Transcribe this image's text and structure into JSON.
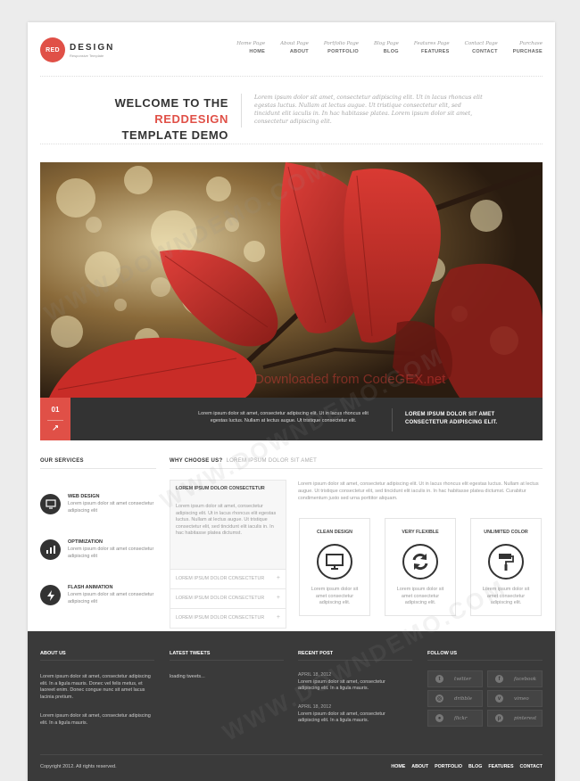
{
  "header": {
    "logo_badge": "RED",
    "logo_name": "DESIGN",
    "logo_tagline": "Responsive Template",
    "nav": [
      {
        "sub": "Home Page",
        "label": "HOME"
      },
      {
        "sub": "About Page",
        "label": "ABOUT"
      },
      {
        "sub": "Portfolio Page",
        "label": "PORTFOLIO"
      },
      {
        "sub": "Blog Page",
        "label": "BLOG"
      },
      {
        "sub": "Features Page",
        "label": "FEATURES"
      },
      {
        "sub": "Contact Page",
        "label": "CONTACT"
      },
      {
        "sub": "Purchase",
        "label": "PURCHASE"
      }
    ]
  },
  "welcome": {
    "line1_prefix": "WELCOME TO THE ",
    "line1_accent": "REDDESIGN",
    "line2": "TEMPLATE DEMO",
    "description": "Lorem ipsum dolor sit amet, consectetur adipiscing elit. Ut in lacus rhoncus elit egestas luctus. Nullam at lectus augue. Ut tristique consectetur elit, sed tincidunt elit iaculis in. In hac habitasse platea. Lorem ipsum dolor sit amet, consectetur adipiscing elit."
  },
  "slider": {
    "number": "01",
    "link_icon": "link-icon",
    "caption": "Lorem ipsum dolor sit amet, consectetur adipiscing elit. Ut in lacus rhoncus elit egestas luctus. Nullam at lectus augue. Ut tristique consectetur elit.",
    "heading": "LOREM IPSUM DOLOR SIT AMET CONSECTETUR ADIPISCING ELIT.",
    "overlay_text": "Downloaded from CodeGEX.net"
  },
  "services": {
    "title": "OUR SERVICES",
    "items": [
      {
        "icon": "monitor-icon",
        "title": "WEB DESIGN",
        "desc": "Lorem ipsum dolor sit amet consectetur adipiscing elit"
      },
      {
        "icon": "chart-icon",
        "title": "OPTIMIZATION",
        "desc": "Lorem ipsum dolor sit amet consectetur adipiscing elit"
      },
      {
        "icon": "flash-icon",
        "title": "FLASH ANIMATION",
        "desc": "Lorem ipsum dolor sit amet consectetur adipiscing elit"
      }
    ]
  },
  "why": {
    "title": "WHY CHOOSE US?",
    "subtitle": "LOREM IPSUM DOLOR SIT AMET",
    "accordion_open": {
      "title": "LOREM IPSUM DOLOR CONSECTETUR",
      "body": "Lorem ipsum dolor sit amet, consectetur adipiscing elit. Ut in lacus rhoncus elit egestas luctus. Nullam at lectus augue. Ut tristique consectetur elit, sed tincidunt elit iaculis in. In hac habitasse platea dictumst."
    },
    "accordion_closed": [
      "LOREM IPSUM DOLOR CONSECTETUR",
      "LOREM IPSUM DOLOR CONSECTETUR",
      "LOREM IPSUM DOLOR CONSECTETUR"
    ],
    "text": "Lorem ipsum dolor sit amet, consectetur adipiscing elit. Ut in lacus rhoncus elit egestas luctus. Nullam at lectus augue. Ut tristique consectetur elit, sed tincidunt elit iaculis in. In hac habitasse platea dictumst. Curabitur condimentum justo sed urna porttitor aliquam.",
    "features": [
      {
        "title": "CLEAN DESIGN",
        "icon": "monitor-icon",
        "desc": "Lorem ipsum dolor sit amet consectetur adipiscing elit."
      },
      {
        "title": "VERY FLEXIBLE",
        "icon": "refresh-icon",
        "desc": "Lorem ipsum dolor sit amet consectetur adipiscing elit."
      },
      {
        "title": "UNLIMITED COLOR",
        "icon": "paint-roller-icon",
        "desc": "Lorem ipsum dolor sit amet consectetur adipiscing elit."
      }
    ]
  },
  "footer": {
    "about_title": "ABOUT US",
    "about_p1": "Lorem ipsum dolor sit amet, consectetur adipiscing elit. In a ligula mauris. Donec vel felis metus, et laoreet enim. Donec congue nunc sit amet lacus lacinia pretium.",
    "about_p2": "Lorem ipsum dolor sit amet, consectetur adipiscing elit. In a ligula mauris.",
    "tweets_title": "LATEST TWEETS",
    "tweets_status": "loading tweets...",
    "posts_title": "RECENT POST",
    "posts": [
      {
        "date": "APRIL 18, 2012",
        "text": "Lorem ipsum dolor sit amet, consectetur adipiscing elit. In a ligula mauris."
      },
      {
        "date": "APRIL 18, 2012",
        "text": "Lorem ipsum dolor sit amet, consectetur adipiscing elit. In a ligula mauris."
      }
    ],
    "follow_title": "FOLLOW US",
    "social": [
      {
        "name": "twitter",
        "icon": "twitter-icon",
        "glyph": "t"
      },
      {
        "name": "facebook",
        "icon": "facebook-icon",
        "glyph": "f"
      },
      {
        "name": "dribble",
        "icon": "dribbble-icon",
        "glyph": "◎"
      },
      {
        "name": "vimeo",
        "icon": "vimeo-icon",
        "glyph": "v"
      },
      {
        "name": "flickr",
        "icon": "flickr-icon",
        "glyph": "●"
      },
      {
        "name": "pinterest",
        "icon": "pinterest-icon",
        "glyph": "p"
      }
    ],
    "copyright": "Copyright 2012. All rights reserved.",
    "nav": [
      "HOME",
      "ABOUT",
      "PORTFOLIO",
      "BLOG",
      "FEATURES",
      "CONTACT"
    ]
  },
  "watermark": "WWW.DOWNDEMO.COM",
  "colors": {
    "accent": "#e05047",
    "dark": "#333333",
    "footer": "#3a3a3a"
  }
}
